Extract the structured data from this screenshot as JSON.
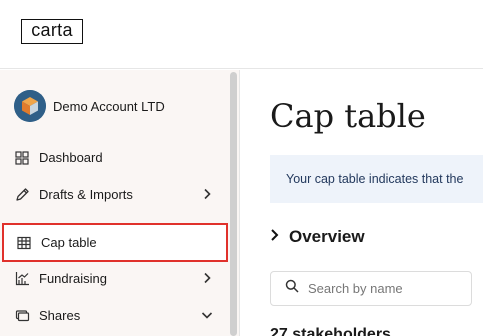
{
  "app": {
    "logo_text": "carta"
  },
  "sidebar": {
    "account_name": "Demo Account LTD",
    "items": [
      {
        "label": "Dashboard",
        "icon": "dashboard-grid-icon",
        "chevron": ""
      },
      {
        "label": "Drafts & Imports",
        "icon": "pencil-icon",
        "chevron": "chevron-right-icon"
      },
      {
        "label": "Cap table",
        "icon": "table-icon",
        "chevron": "",
        "selected": true
      },
      {
        "label": "Fundraising",
        "icon": "chart-icon",
        "chevron": "chevron-right-icon"
      },
      {
        "label": "Shares",
        "icon": "shares-icon",
        "chevron": "chevron-down-icon"
      }
    ]
  },
  "main": {
    "title": "Cap table",
    "banner_text": "Your cap table indicates that the",
    "overview_label": "Overview",
    "search_placeholder": "Search by name",
    "stakeholders_text": "27 stakeholders"
  },
  "colors": {
    "sidebar_bg": "#faf6f4",
    "selected_border": "#e0312b",
    "banner_bg": "#eef3fa",
    "banner_text": "#23395d"
  }
}
